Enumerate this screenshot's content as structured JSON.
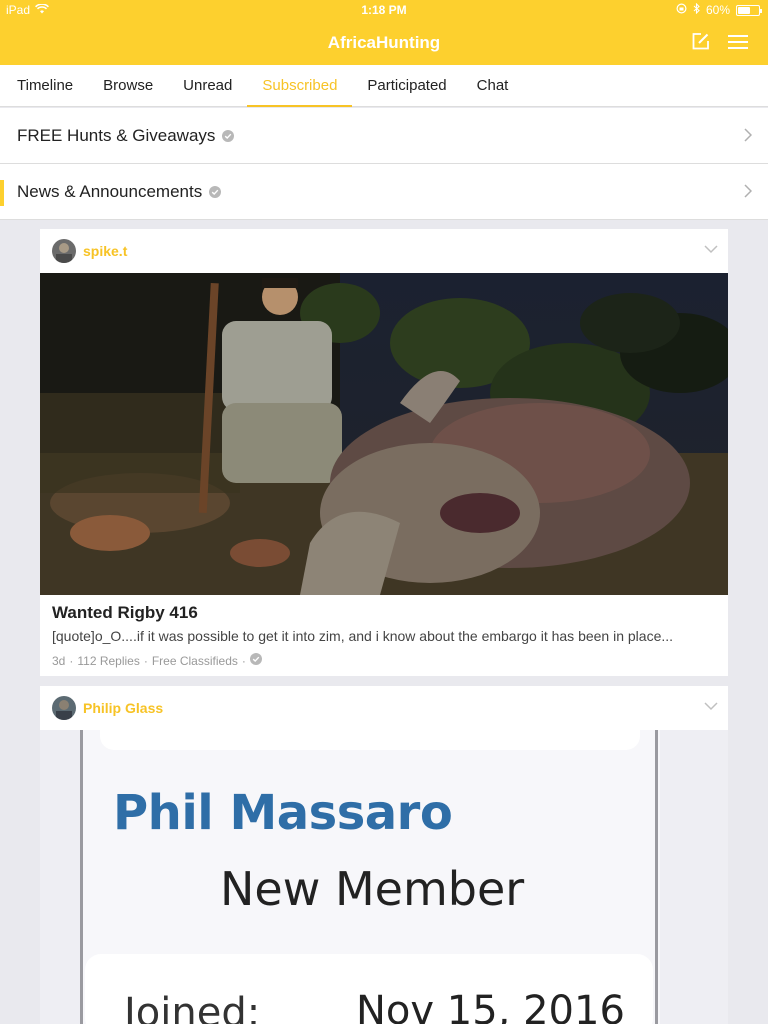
{
  "status_bar": {
    "carrier": "iPad",
    "time": "1:18 PM",
    "battery_text": "60%",
    "battery_level": 0.6
  },
  "nav": {
    "title": "AfricaHunting",
    "accent_color": "#fdd02e",
    "icons": [
      "compose-icon",
      "menu-icon"
    ]
  },
  "tabs": [
    {
      "label": "Timeline",
      "active": false
    },
    {
      "label": "Browse",
      "active": false
    },
    {
      "label": "Unread",
      "active": false
    },
    {
      "label": "Subscribed",
      "active": true
    },
    {
      "label": "Participated",
      "active": false
    },
    {
      "label": "Chat",
      "active": false
    }
  ],
  "pinned": [
    {
      "label": "FREE Hunts & Giveaways"
    },
    {
      "label": "News & Announcements"
    }
  ],
  "posts": [
    {
      "author": "spike.t",
      "title": "Wanted Rigby 416",
      "excerpt": "[quote]o_O....if it was possible to get it into zim, and i know about the embargo it has been in place...",
      "age": "3d",
      "replies": "112 Replies",
      "forum": "Free Classifieds"
    },
    {
      "author": "Philip Glass",
      "image_text": {
        "name": "Phil Massaro",
        "role": "New Member",
        "joined_label": "Joined:",
        "joined_date": "Nov 15, 2016"
      }
    }
  ]
}
